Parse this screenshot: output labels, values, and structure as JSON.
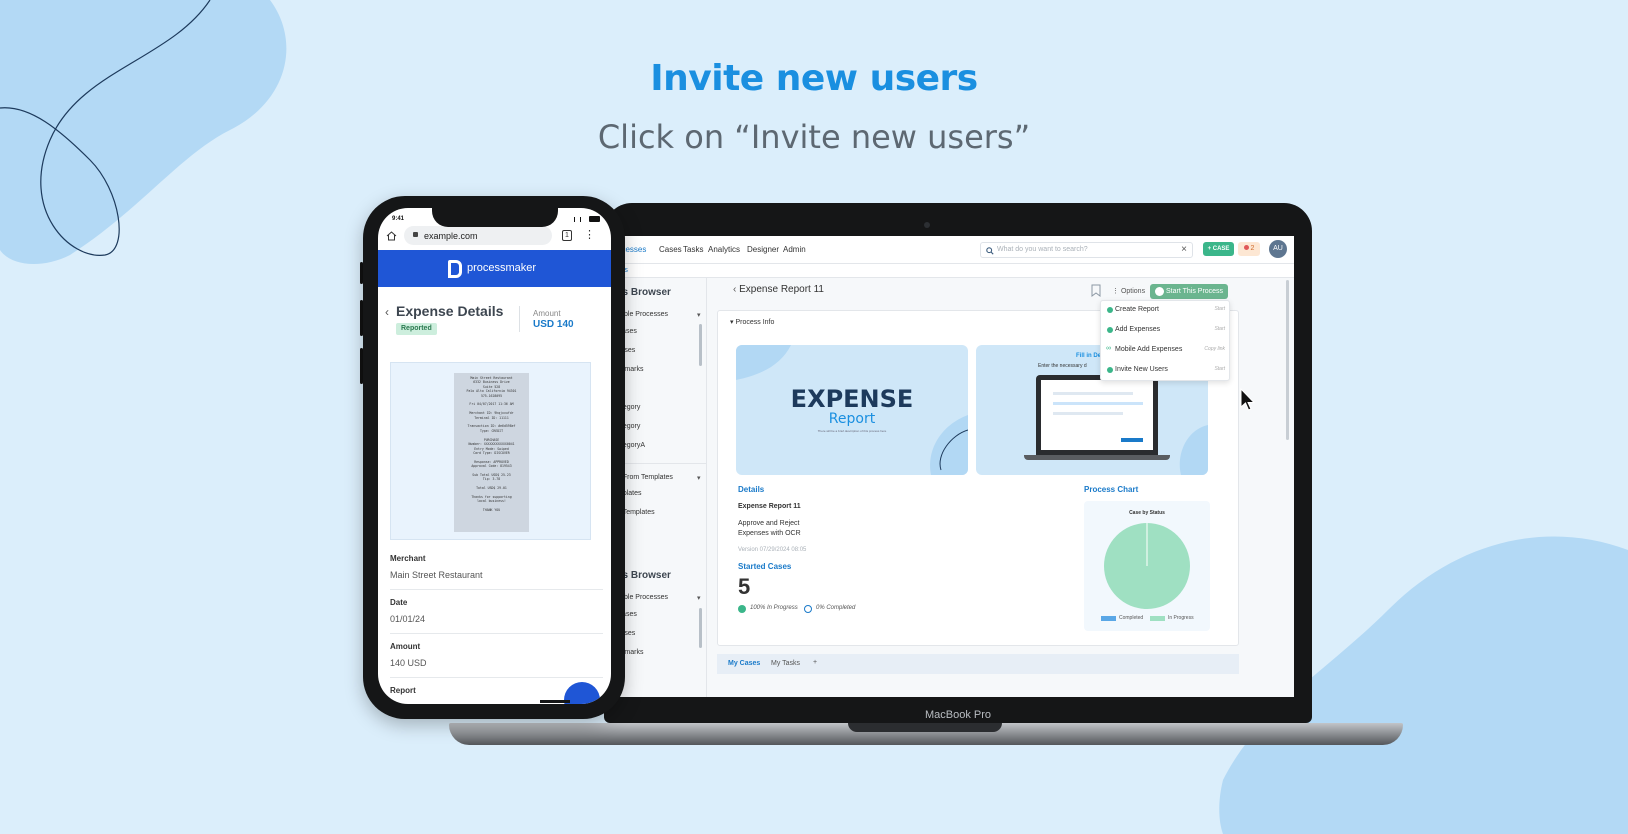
{
  "heading": "Invite new users",
  "subheading": "Click on “Invite new users”",
  "laptop": {
    "label": "MacBook Pro",
    "app": {
      "nav": [
        "ocesses",
        "Cases",
        "Tasks",
        "Analytics",
        "Designer",
        "Admin"
      ],
      "search_placeholder": "What do you want to search?",
      "search_clear": "×",
      "case_button": "+ CASE",
      "notification_count": "2",
      "avatar_initials": "AU",
      "breadcrumb": "ses",
      "browser1": {
        "title": "ss Browser",
        "group1": "ilable Processes",
        "items": [
          "Cases",
          "esses",
          "okmarks",
          "2",
          "ategory",
          "ategory",
          "ategoryA"
        ],
        "group2": "d From Templates",
        "items2": [
          "mplates",
          "d Templates"
        ]
      },
      "browser2": {
        "title": "ss Browser",
        "group1": "ilable Processes",
        "items": [
          "Cases",
          "esses",
          "okmarks"
        ]
      },
      "process_title": "Expense Report 11",
      "options_label": "Options",
      "start_button": "Start This Process",
      "process_info_label": "Process Info",
      "thumb1_title": "EXPENSE",
      "thumb1_sub": "Report",
      "thumb1_note": "There will be a brief description of this process here",
      "thumb2_title": "Fill in De",
      "thumb2_sub": "Enter the necessary d",
      "dropdown": [
        {
          "label": "Create Report",
          "action": "Start",
          "icon": "play-circle-icon"
        },
        {
          "label": "Add Expenses",
          "action": "Start",
          "icon": "play-circle-icon"
        },
        {
          "label": "Mobile Add Expenses",
          "action": "Copy link",
          "icon": "link-icon"
        },
        {
          "label": "Invite New Users",
          "action": "Start",
          "icon": "play-circle-icon"
        }
      ],
      "details": {
        "heading": "Details",
        "name": "Expense Report 11",
        "description_line1": "Approve and Reject",
        "description_line2": "Expenses with OCR",
        "version": "Version 07/29/2024 08:05"
      },
      "started_cases": {
        "heading": "Started Cases",
        "count": "5",
        "in_progress": "100% In Progress",
        "completed": "0% Completed"
      },
      "process_chart": {
        "heading": "Process Chart",
        "title": "Case by Status",
        "legend": [
          "Completed",
          "In Progress"
        ]
      },
      "bottom_tabs": [
        "My Cases",
        "My Tasks",
        "+"
      ]
    }
  },
  "phone": {
    "time": "9:41",
    "url": "example.com",
    "tab_count": "1",
    "brand": "processmaker",
    "title": "Expense Details",
    "status": "Reported",
    "amount_label": "Amount",
    "amount_value": "USD 140",
    "receipt": {
      "lines": [
        "Main Street Restaurant",
        "6332 Business Drive",
        "Suite 528",
        "Palo Alto California 94301",
        "575-1628095",
        "",
        "Fri 04/07/2017 11:36 AM",
        "",
        "Merchant ID: 9hqjxvufdr",
        "Terminal ID: 11111",
        "",
        "Transaction ID: #e6d598ef",
        "Type: CREDIT",
        "",
        "PURCHASE",
        "Number: XXXXXXXXXXXX0041",
        "Entry Mode: Swiped",
        "Card Type: DISCOVER",
        "",
        "Response: APPROVED",
        "Approval Code: 819543",
        "",
        "Sub Total USD$ 25.23",
        "Tip: 3.78",
        "",
        "Total USD$ 29.01",
        "",
        "Thanks for supporting",
        "local business!",
        "",
        "THANK YOU"
      ]
    },
    "fields": [
      {
        "label": "Merchant",
        "value": "Main Street Restaurant"
      },
      {
        "label": "Date",
        "value": "01/01/24"
      },
      {
        "label": "Amount",
        "value": "140 USD"
      },
      {
        "label": "Report",
        "value": ""
      }
    ]
  },
  "colors": {
    "background": "#dbeefb",
    "heading": "#1a8fe0",
    "brand_blue": "#1f56d6",
    "success_green": "#3bb68a",
    "pie_green": "#9fe0c2",
    "pie_blue": "#5aa7e6"
  }
}
